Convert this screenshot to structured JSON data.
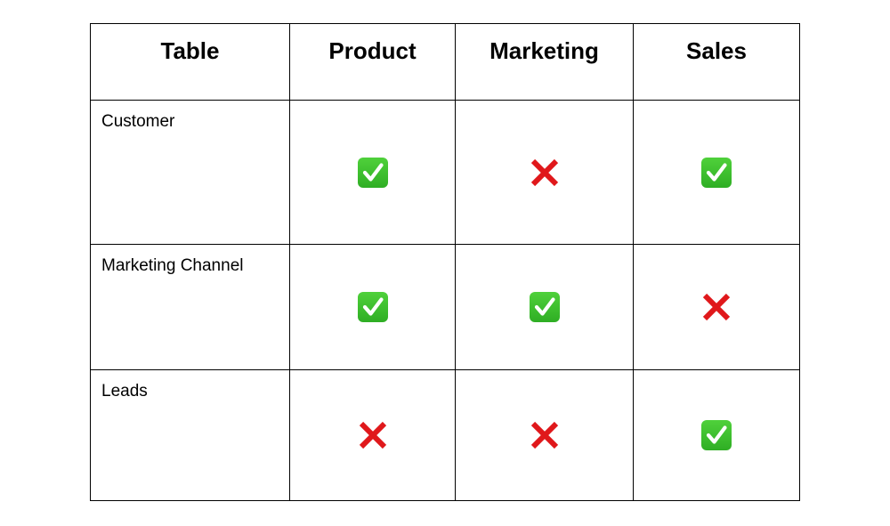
{
  "table": {
    "headers": [
      "Table",
      "Product",
      "Marketing",
      "Sales"
    ],
    "rows": [
      {
        "label": "Customer",
        "marks": [
          "check",
          "cross",
          "check"
        ]
      },
      {
        "label": "Marketing Channel",
        "marks": [
          "check",
          "check",
          "cross"
        ]
      },
      {
        "label": "Leads",
        "marks": [
          "cross",
          "cross",
          "check"
        ]
      }
    ]
  },
  "icons": {
    "check": "green-check-mark-icon",
    "cross": "red-cross-mark-icon"
  },
  "colors": {
    "check_background": "#3cc02e",
    "check_glyph": "#ffffff",
    "cross": "#e0181b",
    "border": "#000000"
  }
}
